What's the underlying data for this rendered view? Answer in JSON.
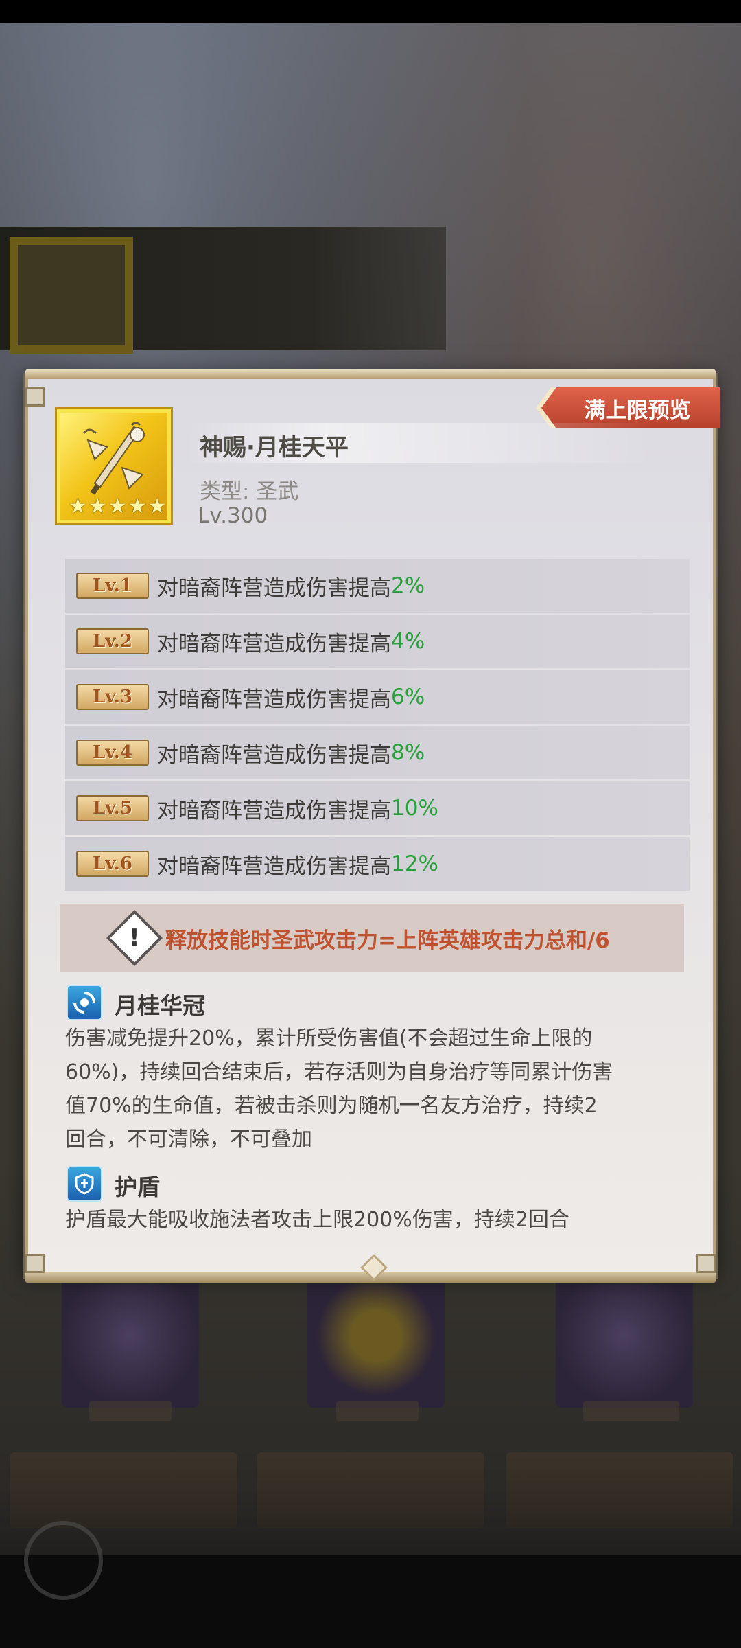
{
  "header": {
    "preview_tag": "满上限预览"
  },
  "weapon": {
    "name": "神赐·月桂天平",
    "type": "类型: 圣武",
    "level": "Lv.300",
    "stars": 5
  },
  "levels": [
    {
      "badge": "Lv.1",
      "text": "对暗裔阵营造成伤害提高",
      "value": "2%"
    },
    {
      "badge": "Lv.2",
      "text": "对暗裔阵营造成伤害提高",
      "value": "4%"
    },
    {
      "badge": "Lv.3",
      "text": "对暗裔阵营造成伤害提高",
      "value": "6%"
    },
    {
      "badge": "Lv.4",
      "text": "对暗裔阵营造成伤害提高",
      "value": "8%"
    },
    {
      "badge": "Lv.5",
      "text": "对暗裔阵营造成伤害提高",
      "value": "10%"
    },
    {
      "badge": "Lv.6",
      "text": "对暗裔阵营造成伤害提高",
      "value": "12%"
    }
  ],
  "warning": {
    "text": "释放技能时圣武攻击力=上阵英雄攻击力总和/6"
  },
  "skills": [
    {
      "title": "月桂华冠",
      "icon": "swirl-icon",
      "lines": [
        "伤害减免提升20%，累计所受伤害值(不会超过生命上限的",
        "60%)，持续回合结束后，若存活则为自身治疗等同累计伤害",
        "值70%的生命值，若被击杀则为随机一名友方治疗，持续2",
        "回合，不可清除，不可叠加"
      ]
    },
    {
      "title": "护盾",
      "icon": "shield-icon",
      "lines": [
        "护盾最大能吸收施法者攻击上限200%伤害，持续2回合"
      ]
    }
  ],
  "colors": {
    "accent_red": "#c0532f",
    "value_green": "#27a23b",
    "tag_red": "#d1553d",
    "gold": "#f2c418"
  }
}
